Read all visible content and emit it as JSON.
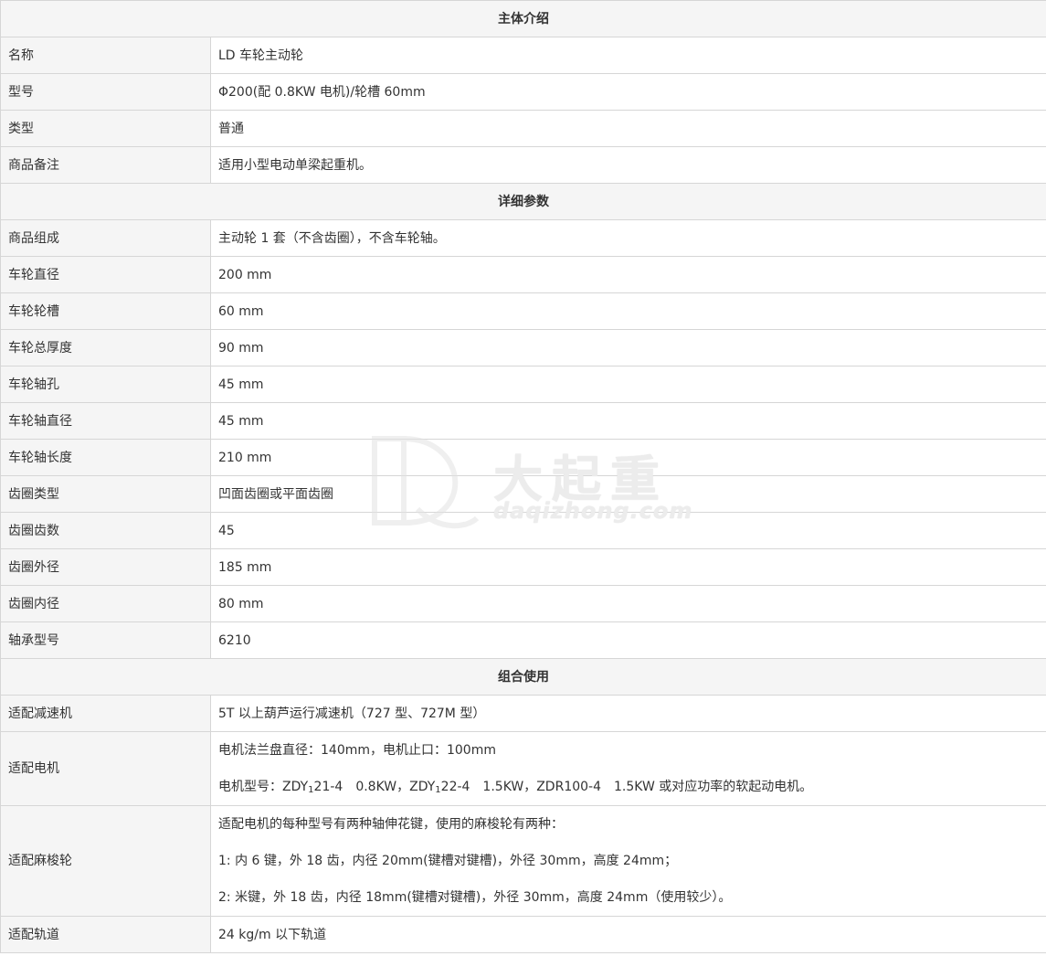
{
  "sections": [
    {
      "title": "主体介绍",
      "rows": [
        {
          "label": "名称",
          "value": "LD 车轮主动轮"
        },
        {
          "label": "型号",
          "value": "Φ200(配 0.8KW 电机)/轮槽 60mm"
        },
        {
          "label": "类型",
          "value": "普通"
        },
        {
          "label": "商品备注",
          "value": "适用小型电动单梁起重机。"
        }
      ]
    },
    {
      "title": "详细参数",
      "rows": [
        {
          "label": "商品组成",
          "value": "主动轮 1 套（不含齿圈），不含车轮轴。"
        },
        {
          "label": "车轮直径",
          "value": "200 mm"
        },
        {
          "label": "车轮轮槽",
          "value": "60 mm"
        },
        {
          "label": "车轮总厚度",
          "value": "90 mm"
        },
        {
          "label": "车轮轴孔",
          "value": "45 mm"
        },
        {
          "label": "车轮轴直径",
          "value": "45 mm"
        },
        {
          "label": "车轮轴长度",
          "value": "210 mm"
        },
        {
          "label": "齿圈类型",
          "value": "凹面齿圈或平面齿圈"
        },
        {
          "label": "齿圈齿数",
          "value": "45"
        },
        {
          "label": "齿圈外径",
          "value": "185 mm"
        },
        {
          "label": "齿圈内径",
          "value": "80 mm"
        },
        {
          "label": "轴承型号",
          "value": "6210"
        }
      ]
    },
    {
      "title": "组合使用",
      "rows": [
        {
          "label": "适配减速机",
          "value": "5T 以上葫芦运行减速机（727 型、727M 型）"
        }
      ]
    }
  ],
  "motor": {
    "label": "适配电机",
    "line1": "电机法兰盘直径：140mm，电机止口：100mm",
    "line2_prefix": "电机型号：ZDY",
    "sub1": "1",
    "line2_mid1": "21-4　0.8KW，ZDY",
    "sub2": "1",
    "line2_rest": "22-4　1.5KW，ZDR100-4　1.5KW 或对应功率的软起动电机。"
  },
  "pinion": {
    "label": "适配麻梭轮",
    "line1": "适配电机的每种型号有两种轴伸花键，使用的麻梭轮有两种：",
    "line2": "1:  内 6 键，外 18 齿，内径 20mm(键槽对键槽)，外径 30mm，高度 24mm；",
    "line3": "2:  米键，外 18 齿，内径 18mm(键槽对键槽)，外径 30mm，高度 24mm（使用较少）。"
  },
  "rail": {
    "label": "适配轨道",
    "value": "24 kg/m 以下轨道"
  },
  "watermark": {
    "brand": "大起重",
    "domain": "daqizhong.com",
    "logo_icon": "dq-logo-icon"
  }
}
